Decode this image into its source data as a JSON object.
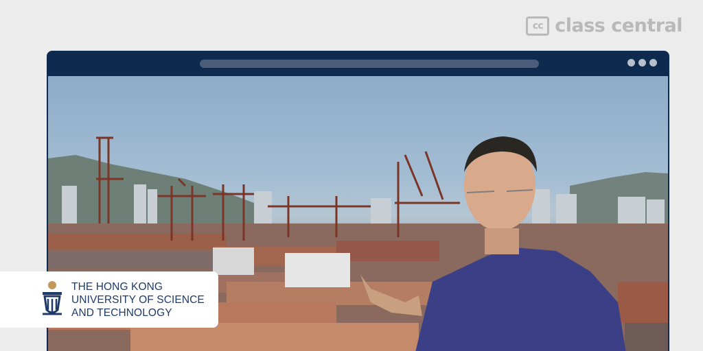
{
  "brand": {
    "mark": "cc",
    "name": "class central",
    "icon": "class-central-logo-icon"
  },
  "window": {
    "accent": "#0e2a4e",
    "controls": [
      "dot",
      "dot",
      "dot"
    ]
  },
  "video": {
    "scene": "lecture-video-frame"
  },
  "university": {
    "name_lines": [
      "THE HONG KONG",
      "UNIVERSITY OF SCIENCE",
      "AND TECHNOLOGY"
    ],
    "color": "#1f3a66",
    "logo_icon": "hkust-logo-icon"
  }
}
